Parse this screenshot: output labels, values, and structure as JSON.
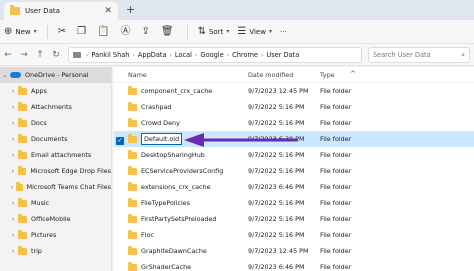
{
  "tab": {
    "title": "User Data",
    "close": "✕",
    "newtab": "+"
  },
  "toolbar": {
    "new_label": "New",
    "sort_label": "Sort",
    "view_label": "View",
    "more": "···"
  },
  "nav": {
    "back": "←",
    "forward": "→",
    "up": "↑",
    "refresh": "↻"
  },
  "address": {
    "crumbs": [
      "Pankil Shah",
      "AppData",
      "Local",
      "Google",
      "Chrome",
      "User Data"
    ]
  },
  "search": {
    "placeholder": "Search User Data"
  },
  "navpane": {
    "items": [
      {
        "label": "OneDrive - Personal",
        "type": "cloud"
      },
      {
        "label": "Apps"
      },
      {
        "label": "Attachments"
      },
      {
        "label": "Docs"
      },
      {
        "label": "Documents"
      },
      {
        "label": "Email attachments"
      },
      {
        "label": "Microsoft Edge Drop Files"
      },
      {
        "label": "Microsoft Teams Chat Files"
      },
      {
        "label": "Music"
      },
      {
        "label": "OfficeMobile"
      },
      {
        "label": "Pictures"
      },
      {
        "label": "trip"
      }
    ]
  },
  "files": {
    "headers": {
      "name": "Name",
      "date": "Date modified",
      "type": "Type"
    },
    "rows": [
      {
        "name": "component_crx_cache",
        "date": "9/7/2023 12:45 PM",
        "type": "File folder"
      },
      {
        "name": "Crashpad",
        "date": "9/7/2022 5:16 PM",
        "type": "File folder"
      },
      {
        "name": "Crowd Deny",
        "date": "9/7/2022 5:16 PM",
        "type": "File folder"
      },
      {
        "name": "Default.old",
        "date": "9/7/2023 6:38 PM",
        "type": "File folder",
        "selected": true
      },
      {
        "name": "DesktopSharingHub",
        "date": "9/7/2022 5:16 PM",
        "type": "File folder"
      },
      {
        "name": "ECServiceProvidersConfig",
        "date": "9/7/2022 5:16 PM",
        "type": "File folder"
      },
      {
        "name": "extensions_crx_cache",
        "date": "9/7/2023 6:46 PM",
        "type": "File folder"
      },
      {
        "name": "FileTypePolicies",
        "date": "9/7/2022 5:16 PM",
        "type": "File folder"
      },
      {
        "name": "FirstPartySetsPreloaded",
        "date": "9/7/2022 5:16 PM",
        "type": "File folder"
      },
      {
        "name": "Floc",
        "date": "9/7/2022 5:16 PM",
        "type": "File folder"
      },
      {
        "name": "GraphiteDawnCache",
        "date": "9/7/2023 12:45 PM",
        "type": "File folder"
      },
      {
        "name": "GrShaderCache",
        "date": "9/7/2023 6:46 PM",
        "type": "File folder"
      }
    ]
  },
  "colors": {
    "accent": "#0067c0",
    "selection": "#cce8ff",
    "folder": "#f6c243",
    "arrow": "#6a2bb0"
  }
}
